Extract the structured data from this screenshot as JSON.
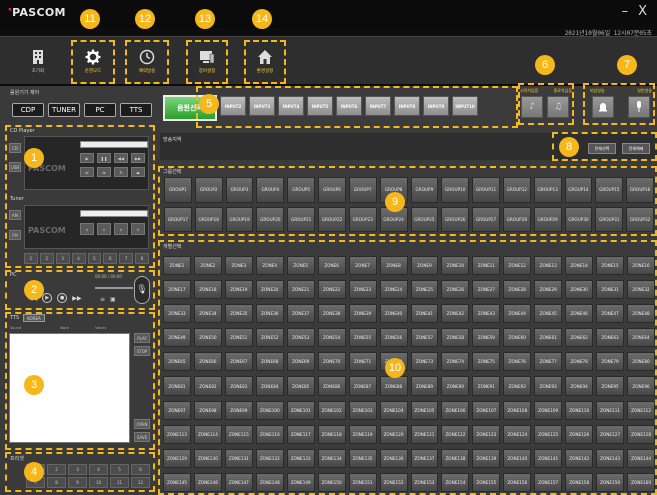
{
  "app": {
    "logo": "PASCOM",
    "datetime": "2021년10월06일 12시07분05초",
    "window_controls": [
      "–",
      "X"
    ]
  },
  "menu": [
    {
      "label": "초기화",
      "icon": "building-icon"
    },
    {
      "label": "운영모드",
      "icon": "gear-icon"
    },
    {
      "label": "예약방송",
      "icon": "clock-icon"
    },
    {
      "label": "장비설정",
      "icon": "monitor-icon"
    },
    {
      "label": "환경설정",
      "icon": "home-icon"
    }
  ],
  "badges": [
    "1",
    "2",
    "3",
    "4",
    "5",
    "6",
    "7",
    "8",
    "9",
    "10",
    "11",
    "12",
    "13",
    "14"
  ],
  "source_panel": {
    "title": "음원기기 제어",
    "buttons": [
      "CDP",
      "TUNER",
      "PC",
      "TTS"
    ]
  },
  "cd_player": {
    "title": "CD Player",
    "side_buttons": [
      "CD",
      "USB"
    ],
    "brand": "PASCOM"
  },
  "tuner": {
    "title": "Tuner",
    "side_buttons": [
      "AM",
      "FM"
    ],
    "brand": "PASCOM",
    "presets": [
      "1",
      "2",
      "3",
      "4",
      "5",
      "6",
      "7",
      "8"
    ]
  },
  "pc": {
    "title": "PC",
    "time": "00:00 / 00:00"
  },
  "tts": {
    "title": "TTS",
    "tab": "KOREA",
    "labels": [
      "Sound",
      "Word",
      "Voices"
    ],
    "side_buttons": [
      "PLAY",
      "STOP",
      "OPEN",
      "SAVE"
    ]
  },
  "presets_panel": {
    "title": "프리셋",
    "items": [
      "1",
      "2",
      "3",
      "4",
      "5",
      "6",
      "7",
      "8",
      "9",
      "10",
      "11",
      "12"
    ]
  },
  "music_select": {
    "label": "음원선택",
    "inputs": [
      "INPUT2",
      "INPUT3",
      "INPUT4",
      "INPUT5",
      "INPUT6",
      "INPUT7",
      "INPUT8",
      "INPUT9",
      "INPUT10"
    ]
  },
  "mic_block": {
    "labels": [
      "시작차임음",
      "종료차임음"
    ]
  },
  "broadcast_block": {
    "labels": [
      "비상방송",
      "일반방송"
    ]
  },
  "broadcast_zone": {
    "label": "방송지역",
    "buttons": [
      "전체선택",
      "전체해제"
    ]
  },
  "group_select": {
    "label": "그룹선택",
    "items": [
      "GROUP1",
      "GROUP2",
      "GROUP3",
      "GROUP4",
      "GROUP5",
      "GROUP6",
      "GROUP7",
      "GROUP8",
      "GROUP9",
      "GROUP10",
      "GROUP11",
      "GROUP12",
      "GROUP13",
      "GROUP14",
      "GROUP15",
      "GROUP16",
      "GROUP17",
      "GROUP18",
      "GROUP19",
      "GROUP20",
      "GROUP21",
      "GROUP22",
      "GROUP23",
      "GROUP24",
      "GROUP25",
      "GROUP26",
      "GROUP27",
      "GROUP28",
      "GROUP29",
      "GROUP30",
      "GROUP31",
      "GROUP32"
    ]
  },
  "zone_select": {
    "label": "개별선택",
    "items": [
      "ZONE1",
      "ZONE2",
      "ZONE3",
      "ZONE4",
      "ZONE5",
      "ZONE6",
      "ZONE7",
      "ZONE8",
      "ZONE9",
      "ZONE10",
      "ZONE11",
      "ZONE12",
      "ZONE13",
      "ZONE14",
      "ZONE15",
      "ZONE16",
      "ZONE17",
      "ZONE18",
      "ZONE19",
      "ZONE20",
      "ZONE21",
      "ZONE22",
      "ZONE23",
      "ZONE24",
      "ZONE25",
      "ZONE26",
      "ZONE27",
      "ZONE28",
      "ZONE29",
      "ZONE30",
      "ZONE31",
      "ZONE32",
      "ZONE33",
      "ZONE34",
      "ZONE35",
      "ZONE36",
      "ZONE37",
      "ZONE38",
      "ZONE39",
      "ZONE40",
      "ZONE41",
      "ZONE42",
      "ZONE43",
      "ZONE44",
      "ZONE45",
      "ZONE46",
      "ZONE47",
      "ZONE48",
      "ZONE49",
      "ZONE50",
      "ZONE51",
      "ZONE52",
      "ZONE53",
      "ZONE54",
      "ZONE55",
      "ZONE56",
      "ZONE57",
      "ZONE58",
      "ZONE59",
      "ZONE60",
      "ZONE61",
      "ZONE62",
      "ZONE63",
      "ZONE64",
      "ZONE65",
      "ZONE66",
      "ZONE67",
      "ZONE68",
      "ZONE69",
      "ZONE70",
      "ZONE71",
      "ZONE72",
      "ZONE73",
      "ZONE74",
      "ZONE75",
      "ZONE76",
      "ZONE77",
      "ZONE78",
      "ZONE79",
      "ZONE80",
      "ZONE81",
      "ZONE82",
      "ZONE83",
      "ZONE84",
      "ZONE85",
      "ZONE86",
      "ZONE87",
      "ZONE88",
      "ZONE89",
      "ZONE90",
      "ZONE91",
      "ZONE92",
      "ZONE93",
      "ZONE94",
      "ZONE95",
      "ZONE96",
      "ZONE97",
      "ZONE98",
      "ZONE99",
      "ZONE100",
      "ZONE101",
      "ZONE102",
      "ZONE103",
      "ZONE104",
      "ZONE105",
      "ZONE106",
      "ZONE107",
      "ZONE108",
      "ZONE109",
      "ZONE110",
      "ZONE111",
      "ZONE112",
      "ZONE113",
      "ZONE114",
      "ZONE115",
      "ZONE116",
      "ZONE117",
      "ZONE118",
      "ZONE119",
      "ZONE120",
      "ZONE121",
      "ZONE122",
      "ZONE123",
      "ZONE124",
      "ZONE125",
      "ZONE126",
      "ZONE127",
      "ZONE128",
      "ZONE129",
      "ZONE130",
      "ZONE131",
      "ZONE132",
      "ZONE133",
      "ZONE134",
      "ZONE135",
      "ZONE136",
      "ZONE137",
      "ZONE138",
      "ZONE139",
      "ZONE140",
      "ZONE141",
      "ZONE142",
      "ZONE143",
      "ZONE144",
      "ZONE145",
      "ZONE146",
      "ZONE147",
      "ZONE148",
      "ZONE149",
      "ZONE150",
      "ZONE151",
      "ZONE152",
      "ZONE153",
      "ZONE154",
      "ZONE155",
      "ZONE156",
      "ZONE157",
      "ZONE158",
      "ZONE159",
      "ZONE160"
    ]
  }
}
